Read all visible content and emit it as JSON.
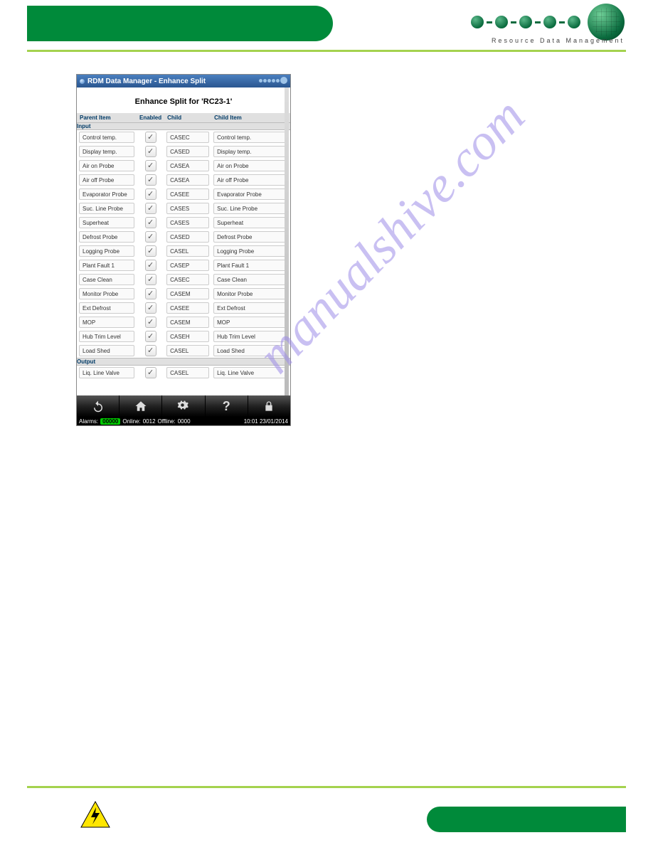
{
  "header": {
    "brand": "Resource Data Management"
  },
  "app": {
    "title": "RDM Data Manager - Enhance Split",
    "heading": "Enhance Split for 'RC23-1'",
    "columns": {
      "parent": "Parent Item",
      "enabled": "Enabled",
      "child": "Child",
      "child_item": "Child Item"
    },
    "section_input": "Input",
    "section_output": "Output",
    "rows_input": [
      {
        "parent": "Control temp.",
        "enabled": true,
        "child": "CASEC",
        "item": "Control temp."
      },
      {
        "parent": "Display temp.",
        "enabled": true,
        "child": "CASED",
        "item": "Display temp."
      },
      {
        "parent": "Air on Probe",
        "enabled": true,
        "child": "CASEA",
        "item": "Air on Probe"
      },
      {
        "parent": "Air off Probe",
        "enabled": true,
        "child": "CASEA",
        "item": "Air off Probe"
      },
      {
        "parent": "Evaporator Probe",
        "enabled": true,
        "child": "CASEE",
        "item": "Evaporator Probe"
      },
      {
        "parent": "Suc. Line Probe",
        "enabled": true,
        "child": "CASES",
        "item": "Suc. Line Probe"
      },
      {
        "parent": "Superheat",
        "enabled": true,
        "child": "CASES",
        "item": "Superheat"
      },
      {
        "parent": "Defrost Probe",
        "enabled": true,
        "child": "CASED",
        "item": "Defrost Probe"
      },
      {
        "parent": "Logging Probe",
        "enabled": true,
        "child": "CASEL",
        "item": "Logging Probe"
      },
      {
        "parent": "Plant Fault 1",
        "enabled": true,
        "child": "CASEP",
        "item": "Plant Fault 1"
      },
      {
        "parent": "Case Clean",
        "enabled": true,
        "child": "CASEC",
        "item": "Case Clean"
      },
      {
        "parent": "Monitor Probe",
        "enabled": true,
        "child": "CASEM",
        "item": "Monitor Probe"
      },
      {
        "parent": "Ext Defrost",
        "enabled": true,
        "child": "CASEE",
        "item": "Ext Defrost"
      },
      {
        "parent": "MOP",
        "enabled": true,
        "child": "CASEM",
        "item": "MOP"
      },
      {
        "parent": "Hub Trim Level",
        "enabled": true,
        "child": "CASEH",
        "item": "Hub Trim Level"
      },
      {
        "parent": "Load Shed",
        "enabled": true,
        "child": "CASEL",
        "item": "Load Shed"
      }
    ],
    "rows_output": [
      {
        "parent": "Liq. Line Valve",
        "enabled": true,
        "child": "CASEL",
        "item": "Liq. Line Valve"
      }
    ],
    "status": {
      "alarms_lbl": "Alarms:",
      "alarms_val": "00000",
      "online_lbl": "Online:",
      "online_val": "0012",
      "offline_lbl": "Offline:",
      "offline_val": "0000",
      "time": "10:01 23/01/2014"
    }
  },
  "watermark": "manualshive.com"
}
